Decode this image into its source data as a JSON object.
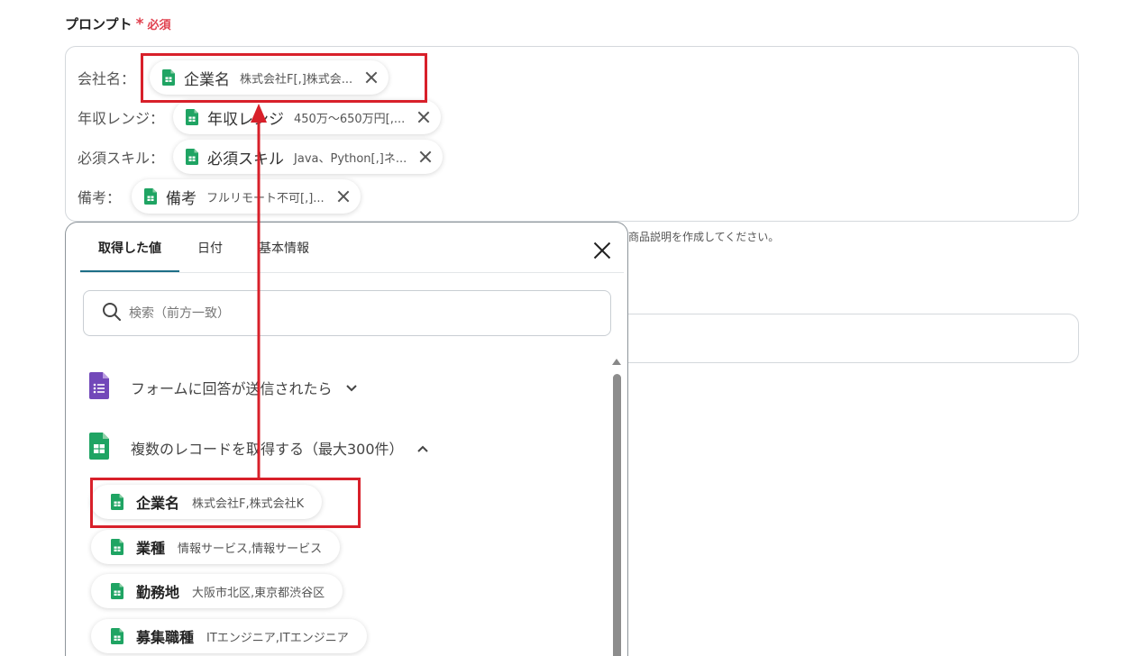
{
  "field": {
    "label": "プロンプト",
    "required_mark": "*",
    "required_text": "必須"
  },
  "prompt_lines": [
    {
      "label": "会社名：",
      "chip": {
        "name": "企業名",
        "value": "株式会社F[,]株式会..."
      }
    },
    {
      "label": "年収レンジ：",
      "chip": {
        "name": "年収レンジ",
        "value": "450万〜650万円[,..."
      }
    },
    {
      "label": "必須スキル：",
      "chip": {
        "name": "必須スキル",
        "value": "Java、Python[,]ネ..."
      }
    },
    {
      "label": "備考：",
      "chip": {
        "name": "備考",
        "value": "フルリモート不可[,]..."
      }
    }
  ],
  "help_text": "商品説明を作成してください。",
  "panel": {
    "tabs": [
      "取得した値",
      "日付",
      "基本情報"
    ],
    "search_placeholder": "検索（前方一致）",
    "sections": [
      {
        "title": "フォームに回答が送信されたら",
        "expanded": false
      },
      {
        "title": "複数のレコードを取得する（最大300件）",
        "expanded": true
      }
    ],
    "items": [
      {
        "name": "企業名",
        "value": "株式会社F,株式会社K"
      },
      {
        "name": "業種",
        "value": "情報サービス,情報サービス"
      },
      {
        "name": "勤務地",
        "value": "大阪市北区,東京都渋谷区"
      },
      {
        "name": "募集職種",
        "value": "ITエンジニア,ITエンジニア"
      }
    ]
  },
  "colors": {
    "required": "#e0404e",
    "highlight": "#d8202a",
    "tab_active": "#1d6f87",
    "sheets_green": "#1fa463",
    "forms_purple": "#7248b9"
  },
  "icons": {
    "sheets": "google-sheets-icon",
    "forms": "google-forms-icon",
    "search": "search-icon",
    "close": "close-icon"
  }
}
